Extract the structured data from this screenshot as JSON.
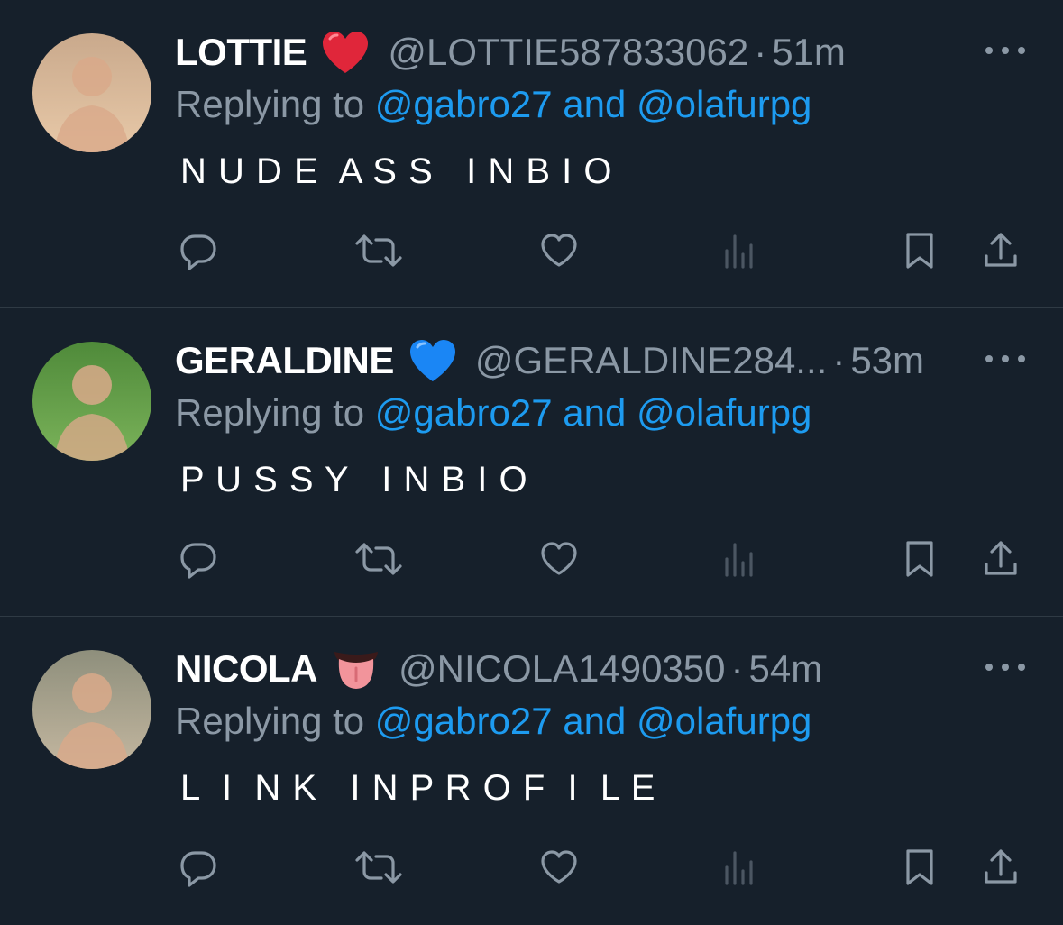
{
  "tweets": [
    {
      "name": "LOTTIE",
      "emoji": "red-heart",
      "handle": "@LOTTIE587833062",
      "time": "51m",
      "replying_prefix": "Replying to",
      "mention_1": "@gabro27",
      "conjunction": "and",
      "mention_2": "@olafurpg",
      "text": "N U D E  A S S   I N B I O",
      "avatar_colors": [
        "#c9a98c",
        "#e8c9a8"
      ]
    },
    {
      "name": "GERALDINE",
      "emoji": "blue-heart",
      "handle": "@GERALDINE284...",
      "time": "53m",
      "replying_prefix": "Replying to",
      "mention_1": "@gabro27",
      "conjunction": "and",
      "mention_2": "@olafurpg",
      "text": "P U S S Y   I N B I O",
      "avatar_colors": [
        "#4f8a3a",
        "#7bb35a"
      ]
    },
    {
      "name": "NICOLA",
      "emoji": "tongue-face",
      "handle": "@NICOLA1490350",
      "time": "54m",
      "replying_prefix": "Replying to",
      "mention_1": "@gabro27",
      "conjunction": "and",
      "mention_2": "@olafurpg",
      "text": "L  I  N K   I N P R O F  I  L E",
      "avatar_colors": [
        "#8e8f7c",
        "#c4b7a0"
      ]
    }
  ],
  "colors": {
    "background": "#16202b",
    "muted": "#8b98a5",
    "mention": "#1d9bf0",
    "divider": "#2f3a44"
  },
  "icons": [
    "reply-icon",
    "retweet-icon",
    "like-icon",
    "views-icon",
    "bookmark-icon",
    "share-icon",
    "more-icon"
  ]
}
